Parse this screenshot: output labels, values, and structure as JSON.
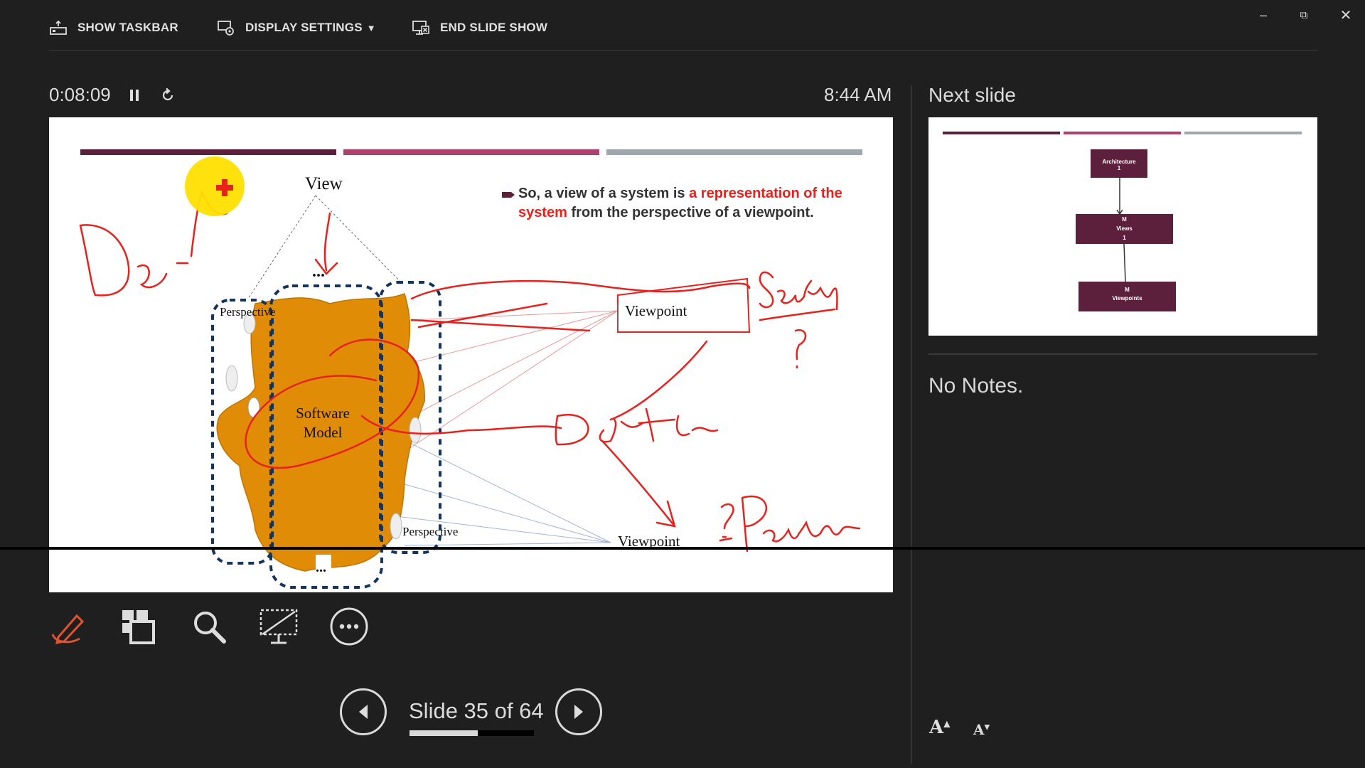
{
  "toolbar": {
    "show_taskbar": "SHOW TASKBAR",
    "display_settings": "DISPLAY SETTINGS",
    "end_slide_show": "END SLIDE SHOW"
  },
  "timer": {
    "elapsed": "0:08:09",
    "clock": "8:44 AM"
  },
  "slide": {
    "bullet_normal_1": "So, a view of a system is ",
    "bullet_red": "a representation of the system",
    "bullet_normal_2": " from the perspective of a viewpoint.",
    "view_label": "View",
    "model_label": "Software Model",
    "perspective_1": "Perspective",
    "perspective_2": "Perspective",
    "viewpoint_1": "Viewpoint",
    "viewpoint_2": "Viewpoint",
    "dots_top": "...",
    "dots_bottom": "...",
    "top_bar_colors": [
      "#5c1f3c",
      "#b0406f",
      "#9ea6ae"
    ],
    "model_color": "#e08c06",
    "ink_color": "#e8211d"
  },
  "next_slide": {
    "title": "Next slide",
    "box1": "Architecture",
    "box1_mult": "1",
    "box2": "Views",
    "box2_mult_top": "M",
    "box2_mult_bottom": "1",
    "box3": "Viewpoints",
    "box3_mult": "M",
    "box_color": "#5c1f3c"
  },
  "notes": {
    "text": "No Notes."
  },
  "tools": [
    "pen-tool-icon",
    "see-all-slides-icon",
    "zoom-icon",
    "black-screen-icon",
    "more-options-icon"
  ],
  "navigation": {
    "slide_count": "Slide 35 of 64",
    "progress": 0.547
  },
  "font": {
    "increase": "A",
    "decrease": "A"
  }
}
